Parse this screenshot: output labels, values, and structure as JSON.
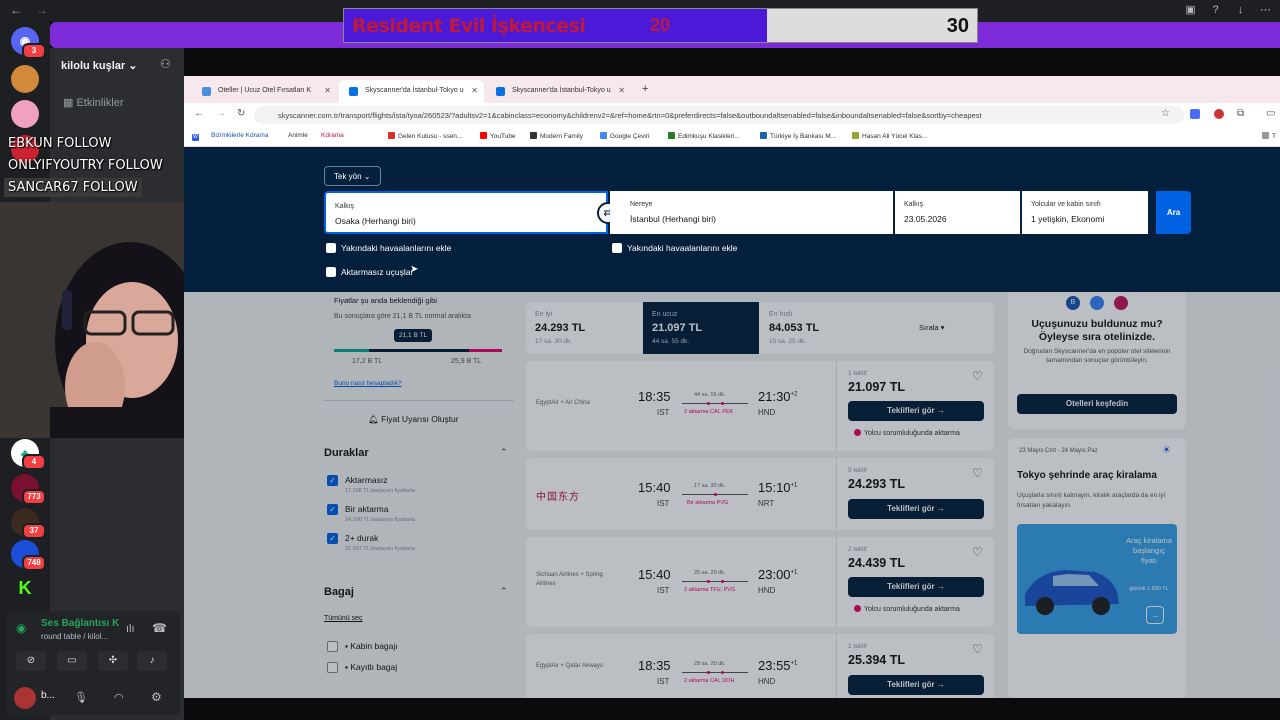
{
  "poll": {
    "title": "Resident Evil İşkencesi",
    "value_left": "20",
    "value_right": "30",
    "fill_fraction": 0.4
  },
  "discord": {
    "server_name": "kilolu kuşlar",
    "events_label": "Etkinlikler",
    "badges": [
      "3",
      "4",
      "773",
      "37",
      "748",
      "4"
    ],
    "voice": {
      "status": "Ses Bağlantısı K",
      "channel": "round table / kilol...",
      "user": "b..."
    }
  },
  "follows": [
    "EBKUN FOLLOW",
    "ONLYIFYOUTRY FOLLOW",
    "SANCAR67 FOLLOW"
  ],
  "browser": {
    "tabs": [
      {
        "label": "Oteller | Ucuz Otel Fırsatları K"
      },
      {
        "label": "Skyscanner'da İstanbul-Tokyo u"
      },
      {
        "label": "Skyscanner'da İstanbul-Tokyo u"
      }
    ],
    "url": "skyscanner.com.tr/transport/flights/ista/tyoa/260523/?adultsv2=1&cabinclass=economy&childrenv2=&ref=home&rtn=0&preferdirects=false&outboundaltsenabled=false&inboundaltsenabled=false&sortby=cheapest",
    "bookmarks": [
      "Bizimkilerle Kdrama",
      "Animle",
      "Kdrama",
      "Gelen Kutusu - ssen...",
      "YouTube",
      "Modern Family",
      "Google Çeviri",
      "Edimkuşu Klasikleri...",
      "Türkiye İş Bankası M...",
      "Hasan Ali Yücel Klas..."
    ]
  },
  "search": {
    "trip_type": "Tek yön",
    "from_label": "Kalkış",
    "from_value": "Osaka (Herhangi biri)",
    "to_label": "Nereye",
    "to_value": "İstanbul (Herhangi biri)",
    "date_label": "Kalkış",
    "date_value": "23.05.2026",
    "pax_label": "Yolcular ve kabin sınıfı",
    "pax_value": "1 yetişkin, Ekonomi",
    "search_button": "Ara",
    "nearby_from": "Yakındaki havaalanlarını ekle",
    "nearby_to": "Yakındaki havaalanlarını ekle",
    "direct_only": "Aktarmasız uçuşlar"
  },
  "price_panel": {
    "title": "Fiyatlar şu anda beklendiği gibi",
    "subtitle": "Bu sonuçlara göre 21,1 B TL normal aralıkta",
    "marker": "21,1 B TL",
    "low": "17,2 B TL",
    "high": "25,9 B TL",
    "link": "Bunu nasıl hesapladık?",
    "alert_button": "Fiyat Uyarısı Oluştur"
  },
  "filters": {
    "stops_title": "Duraklar",
    "stops": [
      {
        "label": "Aktarmasız",
        "sub": "17.208 TL başlayan fiyatlarla"
      },
      {
        "label": "Bir aktarma",
        "sub": "24.290 TL başlayan fiyatlarla"
      },
      {
        "label": "2+ durak",
        "sub": "21.097 TL başlayan fiyatlarla"
      }
    ],
    "bag_title": "Bagaj",
    "select_all": "Tümünü seç",
    "bags": [
      "Kabin bagajı",
      "Kayıtlı bagaj"
    ]
  },
  "sort_tabs": [
    {
      "label": "En iyi",
      "price": "24.293 TL",
      "sub": "17 sa. 30 dk."
    },
    {
      "label": "En ucuz",
      "price": "21.097 TL",
      "sub": "44 sa. 55 dk."
    },
    {
      "label": "En hızlı",
      "price": "84.053 TL",
      "sub": "15 sa. 25 dk."
    }
  ],
  "sort_label": "Sırala",
  "flights": [
    {
      "airline": "EgyptAir + Air China",
      "dep": "18:35",
      "dep_ap": "IST",
      "arr": "21:30",
      "arr_sup": "+2",
      "arr_ap": "HND",
      "dur": "44 sa. 55 dk.",
      "stops": "2 aktarma CAI, PEK",
      "offers": "1 teklif",
      "price": "21.097 TL",
      "button": "Teklifleri gör →",
      "warning": "Yolcu sorumluluğunda aktarma"
    },
    {
      "airline": "",
      "dep": "15:40",
      "dep_ap": "IST",
      "arr": "15:10",
      "arr_sup": "+1",
      "arr_ap": "NRT",
      "dur": "17 sa. 30 dk.",
      "stops": "Bir aktarma PVG",
      "offers": "5 teklif",
      "price": "24.293 TL",
      "button": "Teklifleri gör →",
      "warning": ""
    },
    {
      "airline": "Sichuan Airlines + Spring Airlines",
      "dep": "15:40",
      "dep_ap": "IST",
      "arr": "23:00",
      "arr_sup": "+1",
      "arr_ap": "HND",
      "dur": "25 sa. 20 dk.",
      "stops": "2 aktarma TFU, PVG",
      "offers": "2 teklif",
      "price": "24.439 TL",
      "button": "Teklifleri gör →",
      "warning": "Yolcu sorumluluğunda aktarma"
    },
    {
      "airline": "EgyptAir + Qatar Airways",
      "dep": "18:35",
      "dep_ap": "IST",
      "arr": "23:55",
      "arr_sup": "+1",
      "arr_ap": "HND",
      "dur": "29 sa. 20 dk.",
      "stops": "2 aktarma CAI, DOH",
      "offers": "1 teklif",
      "price": "25.394 TL",
      "button": "Teklifleri gör →",
      "warning": ""
    }
  ],
  "hotel_ad": {
    "title": "Uçuşunuzu buldunuz mu? Öyleyse sıra otelinizde.",
    "body": "Doğrudan Skyscanner'da en popüler otel sitelerinin tamamından sonuçlar görüntüleyin.",
    "button": "Otelleri keşfedin"
  },
  "car_ad": {
    "dates": "23 Mayıs Cmt - 24 Mayıs Paz",
    "title": "Tokyo şehrinde araç kiralama",
    "body": "Uçuşlarla sınırlı kalmayın, kiralık araçlarda da en iyi fırsatları yakalayın.",
    "promo": "Araç kiralama başlangıç fiyatı",
    "promo_sub": "günlük 1.660 TL"
  }
}
